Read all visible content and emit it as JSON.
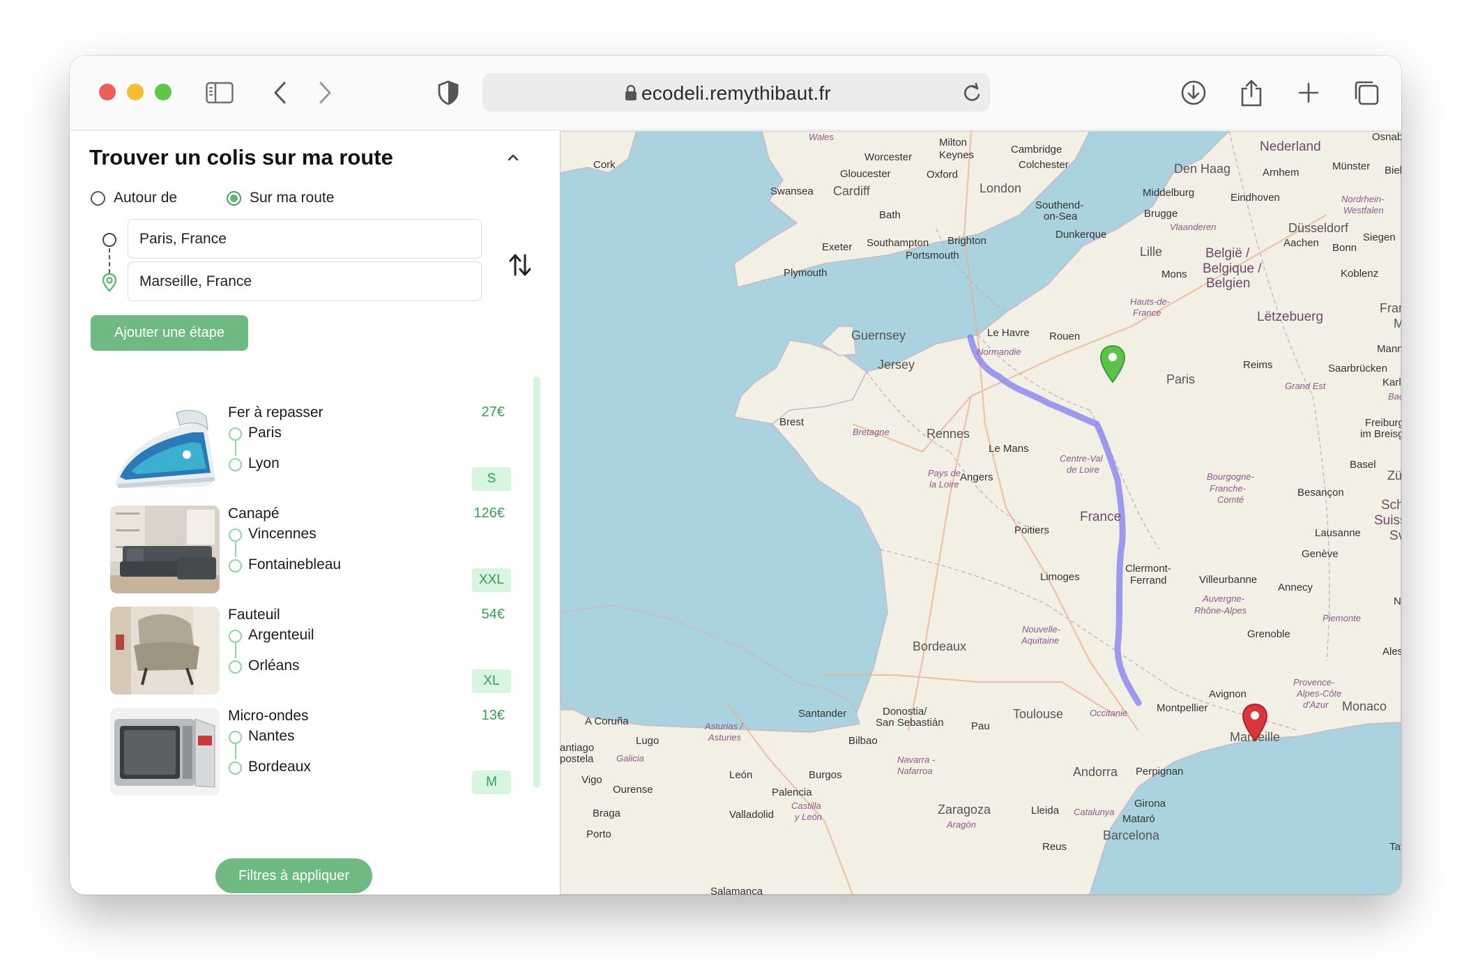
{
  "browser": {
    "url": "ecodeli.remythibaut.fr",
    "icons": [
      "sidebar-icon",
      "back-icon",
      "forward-icon",
      "shield-icon",
      "lock-icon",
      "reload-icon",
      "download-icon",
      "share-icon",
      "new-tab-icon",
      "tabs-overview-icon"
    ]
  },
  "panel": {
    "title": "Trouver un colis sur ma route",
    "radio_options": [
      {
        "label": "Autour de",
        "selected": false
      },
      {
        "label": "Sur ma route",
        "selected": true
      }
    ],
    "origin_value": "Paris, France",
    "destination_value": "Marseille, France",
    "add_stop_label": "Ajouter une étape",
    "filters_label": "Filtres à appliquer",
    "accent_color": "#6fba82"
  },
  "parcels": [
    {
      "title": "Fer à repasser",
      "from": "Paris",
      "to": "Lyon",
      "price": "27€",
      "size": "S",
      "image": "iron"
    },
    {
      "title": "Canapé",
      "from": "Vincennes",
      "to": "Fontainebleau",
      "price": "126€",
      "size": "XXL",
      "image": "sofa"
    },
    {
      "title": "Fauteuil",
      "from": "Argenteuil",
      "to": "Orléans",
      "price": "54€",
      "size": "XL",
      "image": "armchair"
    },
    {
      "title": "Micro-ondes",
      "from": "Nantes",
      "to": "Bordeaux",
      "price": "13€",
      "size": "M",
      "image": "microwave"
    }
  ],
  "map": {
    "labels": {
      "wales": "Wales",
      "cork": "Cork",
      "worcester": "Worcester",
      "milton": "Milton",
      "keynes": "Keynes",
      "cambridge": "Cambridge",
      "colchester": "Colchester",
      "gloucester": "Gloucester",
      "oxford": "Oxford",
      "swansea": "Swansea",
      "cardiff": "Cardiff",
      "london": "London",
      "southend": "Southend-",
      "onsea": "on-Sea",
      "bath": "Bath",
      "exeter": "Exeter",
      "southampton": "Southampton",
      "brighton": "Brighton",
      "portsmouth": "Portsmouth",
      "plymouth": "Plymouth",
      "dunkerque": "Dunkerque",
      "nederland": "Nederland",
      "denhaag": "Den Haag",
      "arnhem": "Arnhem",
      "munster": "Münster",
      "biel": "Biel",
      "osnabruck": "Osnabrüc",
      "middelburg": "Middelburg",
      "eindhoven": "Eindhoven",
      "nordrhein": "Nordrhein-",
      "westfalen": "Westfalen",
      "brugge": "Brugge",
      "vlaanderen": "Vlaanderen",
      "dusseldorf": "Düsseldorf",
      "aachen": "Aachen",
      "bonn": "Bonn",
      "siegen": "Siegen",
      "lille": "Lille",
      "belgie": "België /",
      "belgique": "Belgique /",
      "belgien": "Belgien",
      "mons": "Mons",
      "koblenz": "Koblenz",
      "hautsdefrance": "Hauts-de-",
      "france_r": "France",
      "fran": "Fran",
      "letzebuerg": "Lëtzebuerg",
      "mann": "Mann",
      "guernsey": "Guernsey",
      "jersey": "Jersey",
      "lehavre": "Le Havre",
      "rouen": "Rouen",
      "normandie": "Normandie",
      "paris": "Paris",
      "reims": "Reims",
      "saarbrucken": "Saarbrücken",
      "karls": "Karlsr",
      "grandest": "Grand Est",
      "bad": "Bad",
      "brest": "Brest",
      "bretagne": "Bretagne",
      "rennes": "Rennes",
      "lemans": "Le Mans",
      "freiburg": "Freiburg",
      "imbreisgau": "im Breisgau",
      "centreval": "Centre-Val",
      "deloire": "de Loire",
      "basel": "Basel",
      "zu": "Zü",
      "paysde": "Pays de",
      "laloire": "la Loire",
      "angers": "Angers",
      "bourgogne": "Bourgogne-",
      "franche": "Franche-",
      "comte": "Comté",
      "besancon": "Besançon",
      "schw": "Schw",
      "suisse": "Suisse/S",
      "svi": "Svi",
      "france": "France",
      "poitiers": "Poitiers",
      "lausanne": "Lausanne",
      "geneve": "Genève",
      "limoges": "Limoges",
      "clermont": "Clermont-",
      "ferrand": "Ferrand",
      "villeurbanne": "Villeurbanne",
      "annecy": "Annecy",
      "auvergne": "Auvergne-",
      "rhone": "Rhône-Alpes",
      "nouvelle": "Nouvelle-",
      "aquitaine": "Aquitaine",
      "piemonte": "Piemonte",
      "bordeaux": "Bordeaux",
      "grenoble": "Grenoble",
      "ales": "Aless",
      "provence": "Provence-",
      "alpescote": "Alpes-Côte",
      "dazur": "d'Azur",
      "avignon": "Avignon",
      "monaco": "Monaco",
      "acoruna": "A Coruña",
      "santander": "Santander",
      "donostia": "Donostia/",
      "sansebastian": "San Sebastián",
      "toulouse": "Toulouse",
      "occitanie": "Occitanie",
      "montpellier": "Montpellier",
      "marseille": "Marseille",
      "asturias": "Asturias /",
      "asturies": "Asturies",
      "pau": "Pau",
      "lugo": "Lugo",
      "bilbao": "Bilbao",
      "santiago": "antiago",
      "compostela": "postela",
      "galicia": "Galicia",
      "navarra": "Navarra -",
      "nafarroa": "Nafarroa",
      "andorra": "Andorra",
      "perpignan": "Perpignan",
      "vigo": "Vigo",
      "ourense": "Ourense",
      "leon": "León",
      "burgos": "Burgos",
      "palencia": "Palencia",
      "zaragoza": "Zaragoza",
      "lleida": "Lleida",
      "catalunya": "Catalunya",
      "girona": "Girona",
      "braga": "Braga",
      "valladolid": "Valladolid",
      "castilla": "Castilla",
      "yleon": "y León",
      "aragon": "Aragón",
      "mataro": "Mataró",
      "porto": "Porto",
      "barcelona": "Barcelona",
      "reus": "Reus",
      "salamanca": "Salamanca",
      "tat": "Tat",
      "m": "M",
      "no": "No"
    },
    "route_color": "#7f7cf2",
    "origin_marker_color": "#5cc24a",
    "destination_marker_color": "#d9363e"
  }
}
